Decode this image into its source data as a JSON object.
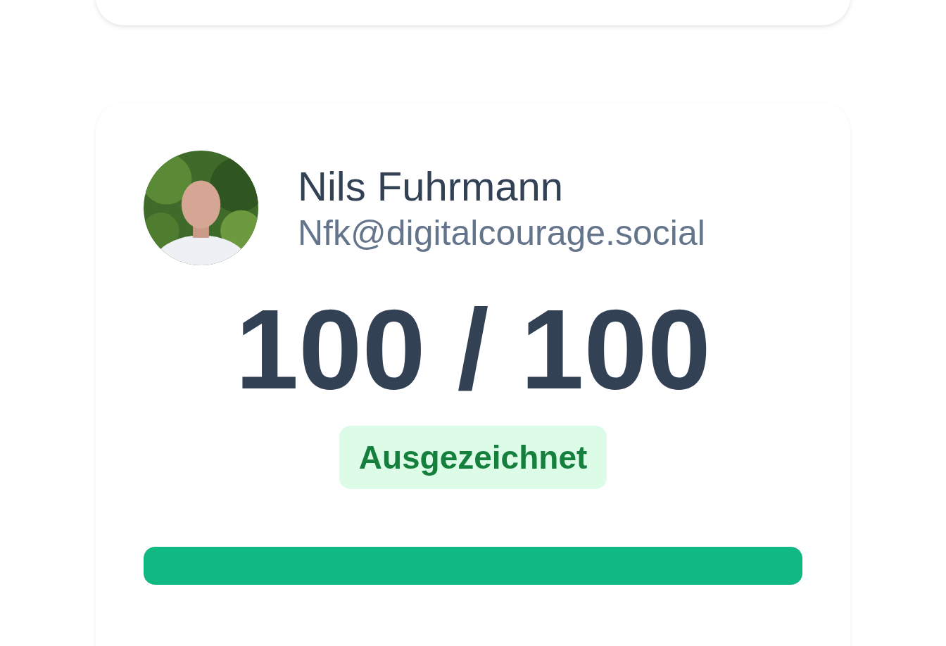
{
  "profile": {
    "name": "Nils Fuhrmann",
    "handle": "Nfk@digitalcourage.social"
  },
  "score": {
    "text": "100 / 100",
    "rating": "Ausgezeichnet",
    "level": 1
  }
}
